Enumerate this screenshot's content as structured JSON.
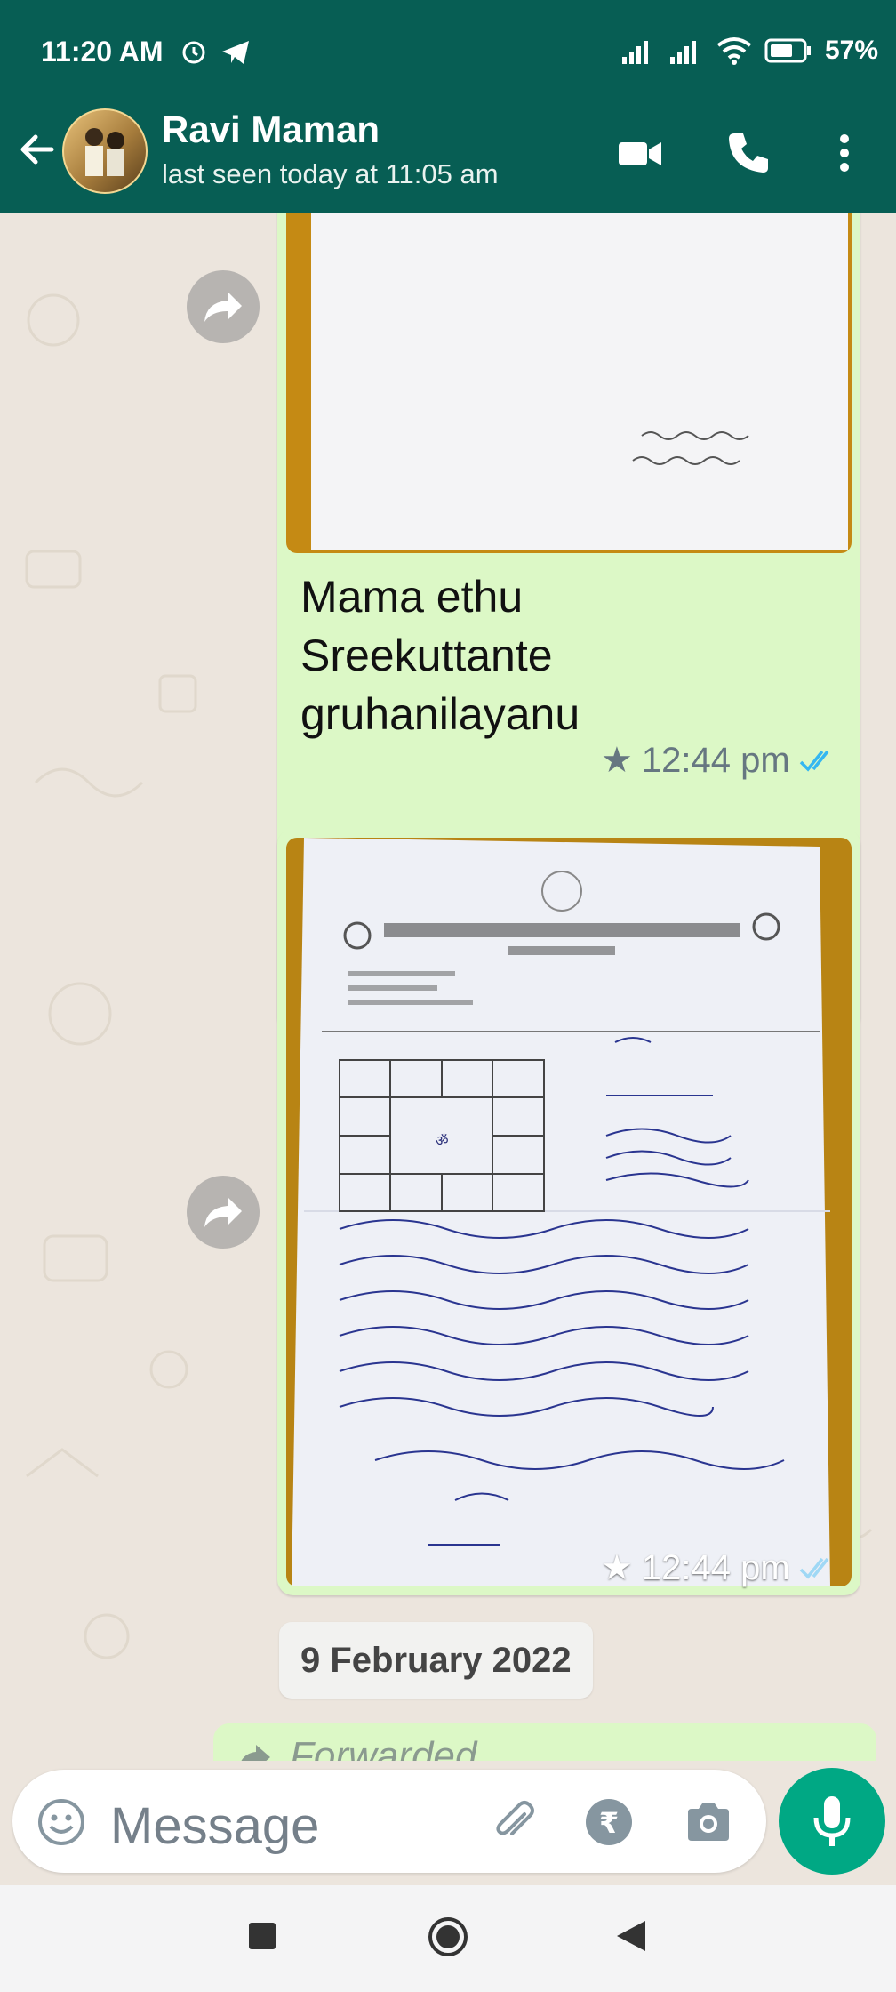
{
  "status_bar": {
    "time": "11:20 AM",
    "battery": "57%",
    "icons": [
      "alarm-icon",
      "telegram-icon",
      "signal-icon",
      "signal-icon",
      "wifi-icon",
      "battery-icon"
    ]
  },
  "header": {
    "contact_name": "Ravi Maman",
    "contact_status": "last seen today at 11:05 am",
    "icons": [
      "back-arrow-icon",
      "video-call-icon",
      "phone-icon",
      "more-vert-icon"
    ]
  },
  "messages": [
    {
      "type": "image",
      "caption": "Mama ethu Sreekuttante gruhanilayanu",
      "time": "12:44 pm",
      "starred": true,
      "read": true
    },
    {
      "type": "image",
      "caption": "",
      "time": "12:44 pm",
      "starred": true,
      "read": true
    }
  ],
  "date_divider": "9 February 2022",
  "forwarded_label": "Forwarded",
  "composer": {
    "placeholder": "Message",
    "icons": [
      "emoji-icon",
      "attach-icon",
      "rupee-payment-icon",
      "camera-icon",
      "mic-icon"
    ]
  },
  "colors": {
    "header_bg": "#075e54",
    "bubble_bg": "#dcf8c6",
    "chat_bg": "#ece5dd",
    "accent": "#00a884",
    "read_tick": "#34b7f1"
  }
}
